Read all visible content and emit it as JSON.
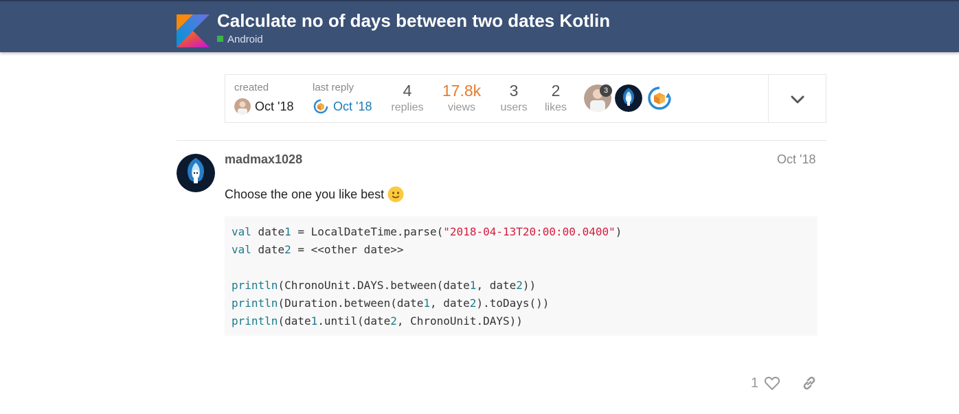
{
  "header": {
    "title": "Calculate no of days between two dates Kotlin",
    "category": "Android",
    "category_color": "#3ab54a",
    "logo_icon": "kotlin-logo"
  },
  "summary": {
    "created_label": "created",
    "created_value": "Oct '18",
    "last_reply_label": "last reply",
    "last_reply_value": "Oct '18",
    "stats": [
      {
        "number": "4",
        "label": "replies"
      },
      {
        "number": "17.8k",
        "label": "views"
      },
      {
        "number": "3",
        "label": "users"
      },
      {
        "number": "2",
        "label": "likes"
      }
    ],
    "participant_badge": "3",
    "expand_icon": "chevron-down-icon"
  },
  "post": {
    "username": "madmax1028",
    "date": "Oct '18",
    "text": "Choose the one you like best",
    "emoji": "slightly-smiling-face",
    "like_count": "1"
  },
  "code": {
    "line1": {
      "kw": "val",
      "a": " date",
      "n": "1",
      "b": " = LocalDateTime.parse(",
      "s": "\"2018-04-13T20:00:00.0400\"",
      "c": ")"
    },
    "line2": {
      "kw": "val",
      "a": " date",
      "n": "2",
      "b": " = <<other date>>"
    },
    "line4": {
      "kw": "println",
      "a": "(ChronoUnit.DAYS.between(date",
      "n1": "1",
      "b": ", date",
      "n2": "2",
      "c": "))"
    },
    "line5": {
      "kw": "println",
      "a": "(Duration.between(date",
      "n1": "1",
      "b": ", date",
      "n2": "2",
      "c": ").toDays())"
    },
    "line6": {
      "kw": "println",
      "a": "(date",
      "n1": "1",
      "b": ".until(date",
      "n2": "2",
      "c": ", ChronoUnit.DAYS))"
    }
  }
}
